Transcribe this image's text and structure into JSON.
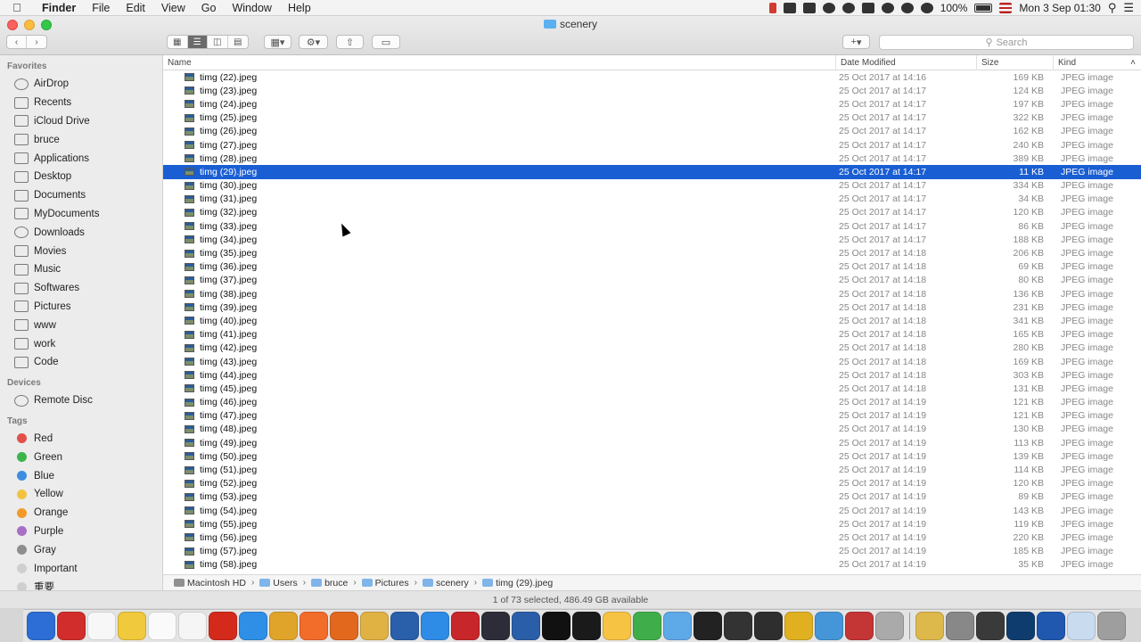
{
  "menubar": {
    "apple_icon": "apple-icon",
    "app_name": "Finder",
    "items": [
      "File",
      "Edit",
      "View",
      "Go",
      "Window",
      "Help"
    ],
    "battery": "100%",
    "clock": "Mon 3 Sep  01:30"
  },
  "window": {
    "title": "scenery",
    "search_placeholder": "Search",
    "add_button": "+"
  },
  "sidebar": {
    "favorites_label": "Favorites",
    "favorites": [
      "AirDrop",
      "Recents",
      "iCloud Drive",
      "bruce",
      "Applications",
      "Desktop",
      "Documents",
      "MyDocuments",
      "Downloads",
      "Movies",
      "Music",
      "Softwares",
      "Pictures",
      "www",
      "work",
      "Code"
    ],
    "devices_label": "Devices",
    "devices": [
      "Remote Disc"
    ],
    "tags_label": "Tags",
    "tags": [
      {
        "name": "Red",
        "color": "#e2504a"
      },
      {
        "name": "Green",
        "color": "#3db44a"
      },
      {
        "name": "Blue",
        "color": "#3d8ee0"
      },
      {
        "name": "Yellow",
        "color": "#f3c33f"
      },
      {
        "name": "Orange",
        "color": "#f39a2b"
      },
      {
        "name": "Purple",
        "color": "#a86fc7"
      },
      {
        "name": "Gray",
        "color": "#8e8e8e"
      },
      {
        "name": "Important",
        "color": "#cfcfcf"
      },
      {
        "name": "重要",
        "color": "#cfcfcf"
      }
    ]
  },
  "columns": {
    "name": "Name",
    "date": "Date Modified",
    "size": "Size",
    "kind": "Kind"
  },
  "files": [
    {
      "name": "timg (22).jpeg",
      "date": "25 Oct 2017 at 14:16",
      "size": "169 KB",
      "kind": "JPEG image"
    },
    {
      "name": "timg (23).jpeg",
      "date": "25 Oct 2017 at 14:17",
      "size": "124 KB",
      "kind": "JPEG image"
    },
    {
      "name": "timg (24).jpeg",
      "date": "25 Oct 2017 at 14:17",
      "size": "197 KB",
      "kind": "JPEG image"
    },
    {
      "name": "timg (25).jpeg",
      "date": "25 Oct 2017 at 14:17",
      "size": "322 KB",
      "kind": "JPEG image"
    },
    {
      "name": "timg (26).jpeg",
      "date": "25 Oct 2017 at 14:17",
      "size": "162 KB",
      "kind": "JPEG image"
    },
    {
      "name": "timg (27).jpeg",
      "date": "25 Oct 2017 at 14:17",
      "size": "240 KB",
      "kind": "JPEG image"
    },
    {
      "name": "timg (28).jpeg",
      "date": "25 Oct 2017 at 14:17",
      "size": "389 KB",
      "kind": "JPEG image"
    },
    {
      "name": "timg (29).jpeg",
      "date": "25 Oct 2017 at 14:17",
      "size": "11 KB",
      "kind": "JPEG image",
      "selected": true
    },
    {
      "name": "timg (30).jpeg",
      "date": "25 Oct 2017 at 14:17",
      "size": "334 KB",
      "kind": "JPEG image"
    },
    {
      "name": "timg (31).jpeg",
      "date": "25 Oct 2017 at 14:17",
      "size": "34 KB",
      "kind": "JPEG image"
    },
    {
      "name": "timg (32).jpeg",
      "date": "25 Oct 2017 at 14:17",
      "size": "120 KB",
      "kind": "JPEG image"
    },
    {
      "name": "timg (33).jpeg",
      "date": "25 Oct 2017 at 14:17",
      "size": "86 KB",
      "kind": "JPEG image"
    },
    {
      "name": "timg (34).jpeg",
      "date": "25 Oct 2017 at 14:17",
      "size": "188 KB",
      "kind": "JPEG image"
    },
    {
      "name": "timg (35).jpeg",
      "date": "25 Oct 2017 at 14:18",
      "size": "206 KB",
      "kind": "JPEG image"
    },
    {
      "name": "timg (36).jpeg",
      "date": "25 Oct 2017 at 14:18",
      "size": "69 KB",
      "kind": "JPEG image"
    },
    {
      "name": "timg (37).jpeg",
      "date": "25 Oct 2017 at 14:18",
      "size": "80 KB",
      "kind": "JPEG image"
    },
    {
      "name": "timg (38).jpeg",
      "date": "25 Oct 2017 at 14:18",
      "size": "136 KB",
      "kind": "JPEG image"
    },
    {
      "name": "timg (39).jpeg",
      "date": "25 Oct 2017 at 14:18",
      "size": "231 KB",
      "kind": "JPEG image"
    },
    {
      "name": "timg (40).jpeg",
      "date": "25 Oct 2017 at 14:18",
      "size": "341 KB",
      "kind": "JPEG image"
    },
    {
      "name": "timg (41).jpeg",
      "date": "25 Oct 2017 at 14:18",
      "size": "165 KB",
      "kind": "JPEG image"
    },
    {
      "name": "timg (42).jpeg",
      "date": "25 Oct 2017 at 14:18",
      "size": "280 KB",
      "kind": "JPEG image"
    },
    {
      "name": "timg (43).jpeg",
      "date": "25 Oct 2017 at 14:18",
      "size": "169 KB",
      "kind": "JPEG image"
    },
    {
      "name": "timg (44).jpeg",
      "date": "25 Oct 2017 at 14:18",
      "size": "303 KB",
      "kind": "JPEG image"
    },
    {
      "name": "timg (45).jpeg",
      "date": "25 Oct 2017 at 14:18",
      "size": "131 KB",
      "kind": "JPEG image"
    },
    {
      "name": "timg (46).jpeg",
      "date": "25 Oct 2017 at 14:19",
      "size": "121 KB",
      "kind": "JPEG image"
    },
    {
      "name": "timg (47).jpeg",
      "date": "25 Oct 2017 at 14:19",
      "size": "121 KB",
      "kind": "JPEG image"
    },
    {
      "name": "timg (48).jpeg",
      "date": "25 Oct 2017 at 14:19",
      "size": "130 KB",
      "kind": "JPEG image"
    },
    {
      "name": "timg (49).jpeg",
      "date": "25 Oct 2017 at 14:19",
      "size": "113 KB",
      "kind": "JPEG image"
    },
    {
      "name": "timg (50).jpeg",
      "date": "25 Oct 2017 at 14:19",
      "size": "139 KB",
      "kind": "JPEG image"
    },
    {
      "name": "timg (51).jpeg",
      "date": "25 Oct 2017 at 14:19",
      "size": "114 KB",
      "kind": "JPEG image"
    },
    {
      "name": "timg (52).jpeg",
      "date": "25 Oct 2017 at 14:19",
      "size": "120 KB",
      "kind": "JPEG image"
    },
    {
      "name": "timg (53).jpeg",
      "date": "25 Oct 2017 at 14:19",
      "size": "89 KB",
      "kind": "JPEG image"
    },
    {
      "name": "timg (54).jpeg",
      "date": "25 Oct 2017 at 14:19",
      "size": "143 KB",
      "kind": "JPEG image"
    },
    {
      "name": "timg (55).jpeg",
      "date": "25 Oct 2017 at 14:19",
      "size": "119 KB",
      "kind": "JPEG image"
    },
    {
      "name": "timg (56).jpeg",
      "date": "25 Oct 2017 at 14:19",
      "size": "220 KB",
      "kind": "JPEG image"
    },
    {
      "name": "timg (57).jpeg",
      "date": "25 Oct 2017 at 14:19",
      "size": "185 KB",
      "kind": "JPEG image"
    },
    {
      "name": "timg (58).jpeg",
      "date": "25 Oct 2017 at 14:19",
      "size": "35 KB",
      "kind": "JPEG image"
    }
  ],
  "pathbar": [
    "Macintosh HD",
    "Users",
    "bruce",
    "Pictures",
    "scenery",
    "timg (29).jpeg"
  ],
  "status": "1 of 73 selected, 486.49 GB available",
  "dock_colors": [
    "#2d6ed6",
    "#d12d2d",
    "#f7f7f7",
    "#f0c93c",
    "#fafafa",
    "#f5f5f5",
    "#d42a1c",
    "#2f8fe6",
    "#e0a42b",
    "#f26c2a",
    "#e2681e",
    "#e0b244",
    "#2a5fa9",
    "#2f8ce6",
    "#c7262a",
    "#2d2d3a",
    "#2b5ea8",
    "#111111",
    "#1a1a1a",
    "#f6c343",
    "#3fae4a",
    "#5ea9e8",
    "#222",
    "#333",
    "#2e2e2e",
    "#e0b020",
    "#4496d9",
    "#c43535",
    "#aaaaaa",
    "#ddb84a",
    "#888",
    "#3a3a3a",
    "#0f3c6e",
    "#2058b0",
    "#c9dbef",
    "#9e9e9e"
  ]
}
